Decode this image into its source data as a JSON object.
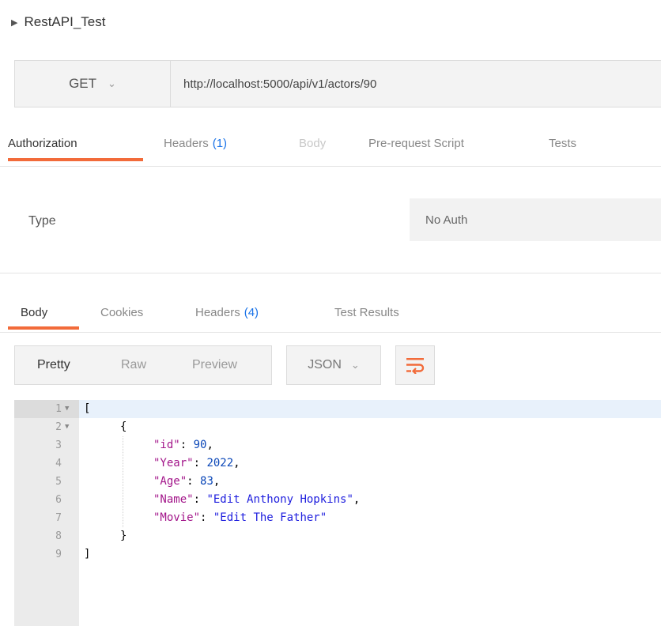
{
  "collection": {
    "name": "RestAPI_Test"
  },
  "request": {
    "method": "GET",
    "url": "http://localhost:5000/api/v1/actors/90"
  },
  "request_tabs": [
    {
      "label": "Authorization",
      "count": ""
    },
    {
      "label": "Headers",
      "count": "(1)"
    },
    {
      "label": "Body",
      "count": ""
    },
    {
      "label": "Pre-request Script",
      "count": ""
    },
    {
      "label": "Tests",
      "count": ""
    }
  ],
  "auth": {
    "type_label": "Type",
    "selected": "No Auth"
  },
  "response_tabs": [
    {
      "label": "Body",
      "count": ""
    },
    {
      "label": "Cookies",
      "count": ""
    },
    {
      "label": "Headers",
      "count": "(4)"
    },
    {
      "label": "Test Results",
      "count": ""
    }
  ],
  "view_modes": [
    "Pretty",
    "Raw",
    "Preview"
  ],
  "format": "JSON",
  "colors": {
    "accent": "#f26b3a",
    "count": "#1a73e8"
  },
  "editor": {
    "lines": [
      "1",
      "2",
      "3",
      "4",
      "5",
      "6",
      "7",
      "8",
      "9"
    ],
    "l1": "[",
    "l2": "{",
    "fields": [
      {
        "key": "\"id\"",
        "value": "90"
      },
      {
        "key": "\"Year\"",
        "value": "2022"
      },
      {
        "key": "\"Age\"",
        "value": "83"
      },
      {
        "key": "\"Name\"",
        "value": "\"Edit Anthony Hopkins\""
      },
      {
        "key": "\"Movie\"",
        "value": "\"Edit The Father\""
      }
    ],
    "l8": "}",
    "l9": "]"
  }
}
